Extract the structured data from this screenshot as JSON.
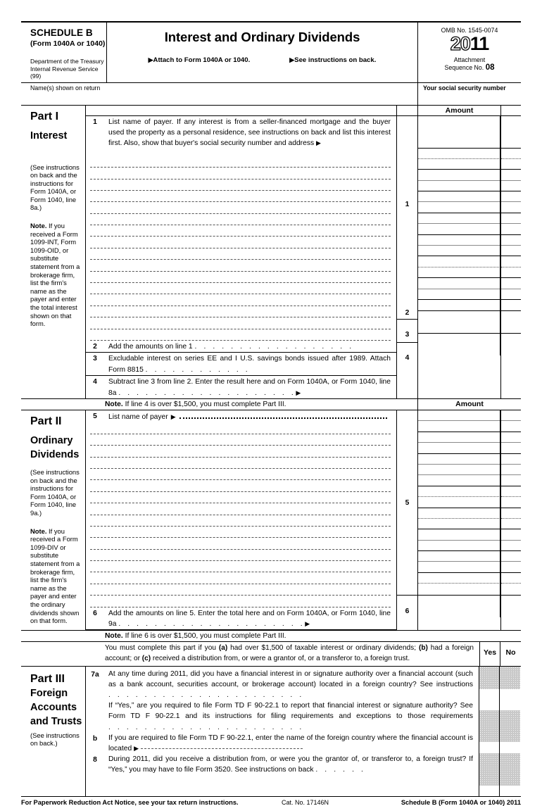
{
  "header": {
    "schedule": "SCHEDULE B",
    "form_ref": "(Form 1040A or 1040)",
    "dept_line1": "Department of the Treasury",
    "dept_line2": "Internal Revenue Service (99)",
    "title": "Interest and Ordinary Dividends",
    "attach_to": "Attach to Form 1040A or 1040.",
    "see_instructions": "See instructions on back.",
    "omb": "OMB No. 1545-0074",
    "year_outline": "20",
    "year_solid": "11",
    "attachment_label": "Attachment",
    "sequence_label": "Sequence No.",
    "sequence_no": "08",
    "name_label": "Name(s) shown on return",
    "ssn_label": "Your social security number"
  },
  "part1": {
    "part_title": "Part I",
    "part_subtitle": "Interest",
    "see_instructions": "(See instructions on back and the instructions for Form 1040A, or Form 1040, line 8a.)",
    "note_bold": "Note.",
    "note_text": " If you received a Form 1099-INT, Form 1099-OID, or substitute statement from a brokerage firm, list the firm's name as the payer and enter the total interest shown on that form.",
    "amount_header": "Amount",
    "line1_num": "1",
    "line1_text": "List name of payer. If any interest is from a seller-financed mortgage and the buyer used the property as a personal residence, see instructions on back and list this interest first. Also, show that buyer's social security number and address",
    "line2_num": "2",
    "line2_text": "Add the amounts on line 1",
    "line3_num": "3",
    "line3_text": "Excludable interest on series EE and I U.S. savings bonds issued after 1989. Attach Form 8815",
    "line4_num": "4",
    "line4_text": "Subtract line 3 from line 2. Enter the result here and on Form 1040A, or Form 1040, line 8a",
    "note_bold2": "Note.",
    "note_after": " If line 4 is over $1,500, you must complete Part III."
  },
  "part2": {
    "part_title": "Part II",
    "part_subtitle_1": "Ordinary",
    "part_subtitle_2": "Dividends",
    "see_instructions": "(See instructions on back and the instructions for Form 1040A, or Form 1040, line 9a.)",
    "note_bold": "Note.",
    "note_text": " If you received a Form 1099-DIV or substitute statement from a brokerage firm, list the firm's name as the payer and enter the ordinary dividends shown on that form.",
    "amount_header": "Amount",
    "line5_num": "5",
    "line5_text": "List name of payer",
    "line6_num": "6",
    "line6_text": "Add the amounts on line 5. Enter the total here and on Form 1040A, or Form 1040, line 9a",
    "note_bold2": "Note.",
    "note_after": " If line 6 is over $1,500, you must complete Part III."
  },
  "part3": {
    "part_title": "Part III",
    "part_subtitle_1": "Foreign",
    "part_subtitle_2": "Accounts",
    "part_subtitle_3": "and Trusts",
    "see_instructions": "(See instructions on back.)",
    "intro_a": "You must complete this part if you ",
    "intro_a_bold": "(a)",
    "intro_b": " had over $1,500 of taxable interest or ordinary dividends; ",
    "intro_b_bold": "(b)",
    "intro_c": " had a foreign account; or ",
    "intro_c_bold": "(c)",
    "intro_d": " received a distribution from, or were a grantor of, or a transferor to, a foreign trust.",
    "yes_label": "Yes",
    "no_label": "No",
    "line7a_num": "7a",
    "line7a_text": "At any time during 2011, did you have a financial interest in or signature authority over a financial account (such as a bank account, securities account, or brokerage account) located in a foreign country? See instructions",
    "line7a_cont": "If “Yes,” are you  required to file Form TD F 90-22.1 to report that financial interest or signature authority? See Form TD F 90-22.1 and its instructions for filing requirements and exceptions to those requirements",
    "line7b_num": "b",
    "line7b_text": "If you are required to file Form TD F 90-22.1, enter the name of the foreign country where the financial account is located",
    "line8_num": "8",
    "line8_text": "During 2011, did you receive a distribution from, or were you the grantor of, or transferor to, a foreign trust? If “Yes,” you may have to file Form 3520. See instructions on back"
  },
  "footer": {
    "paperwork": "For Paperwork Reduction Act Notice, see your tax return instructions.",
    "cat_no": "Cat. No. 17146N",
    "form_id": "Schedule B (Form 1040A or 1040) 2011"
  },
  "icons": {
    "triangle": "▶"
  }
}
